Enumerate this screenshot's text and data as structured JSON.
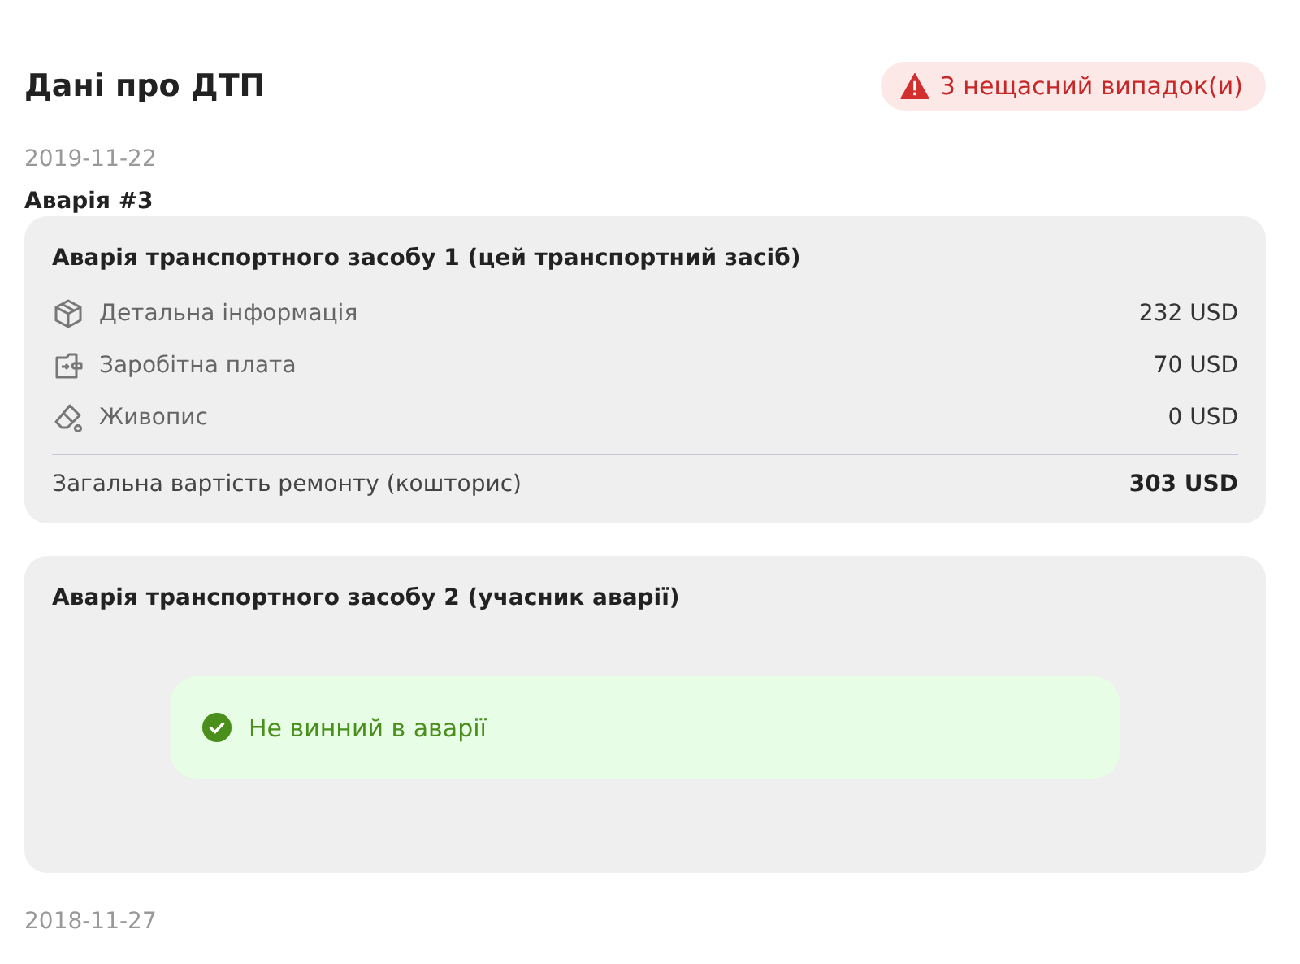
{
  "title": "Дані про ДТП",
  "badge": {
    "text": "3 нещасний випадок(и)"
  },
  "accidents": [
    {
      "date": "2019-11-22",
      "name": "Аварія #3",
      "vehicles": [
        {
          "kind": "costs",
          "title": "Аварія транспортного засобу 1 (цей транспортний засіб)",
          "items": [
            {
              "label": "Детальна інформація",
              "amount": "232 USD"
            },
            {
              "label": "Заробітна плата",
              "amount": "70 USD"
            },
            {
              "label": "Живопис",
              "amount": "0 USD"
            }
          ],
          "total_label": "Загальна вартість ремонту (кошторис)",
          "total": "303 USD"
        },
        {
          "kind": "verdict",
          "title": "Аварія транспортного засобу 2 (учасник аварії)",
          "verdict": "Не винний в аварії"
        }
      ]
    },
    {
      "date": "2018-11-27"
    }
  ]
}
